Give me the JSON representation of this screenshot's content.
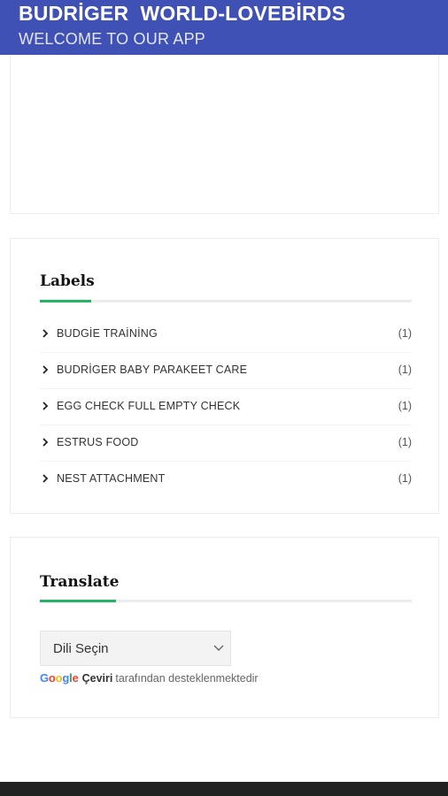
{
  "appbar": {
    "title": "BUDRİGER  WORLD-LOVEBİRDS",
    "subtitle": "WELCOME TO OUR APP",
    "color": "#3f51b5"
  },
  "labels_widget": {
    "title": "Labels",
    "accent_color": "#25b464",
    "items": [
      {
        "label": "BUDGİE TRAİNİNG",
        "count": "(1)"
      },
      {
        "label": "BUDRİGER BABY PARAKEET CARE",
        "count": "(1)"
      },
      {
        "label": "EGG CHECK FULL EMPTY CHECK",
        "count": "(1)"
      },
      {
        "label": "ESTRUS FOOD",
        "count": "(1)"
      },
      {
        "label": "NEST ATTACHMENT",
        "count": "(1)"
      }
    ]
  },
  "translate_widget": {
    "title": "Translate",
    "select_value": "Dili Seçin",
    "powered_brand_letters": [
      "G",
      "o",
      "o",
      "g",
      "l",
      "e"
    ],
    "powered_product": "Çeviri",
    "powered_suffix": "tarafından desteklenmektedir"
  },
  "icons": {
    "chevron": "chevron-right-icon",
    "dropdown": "chevron-down-icon"
  }
}
